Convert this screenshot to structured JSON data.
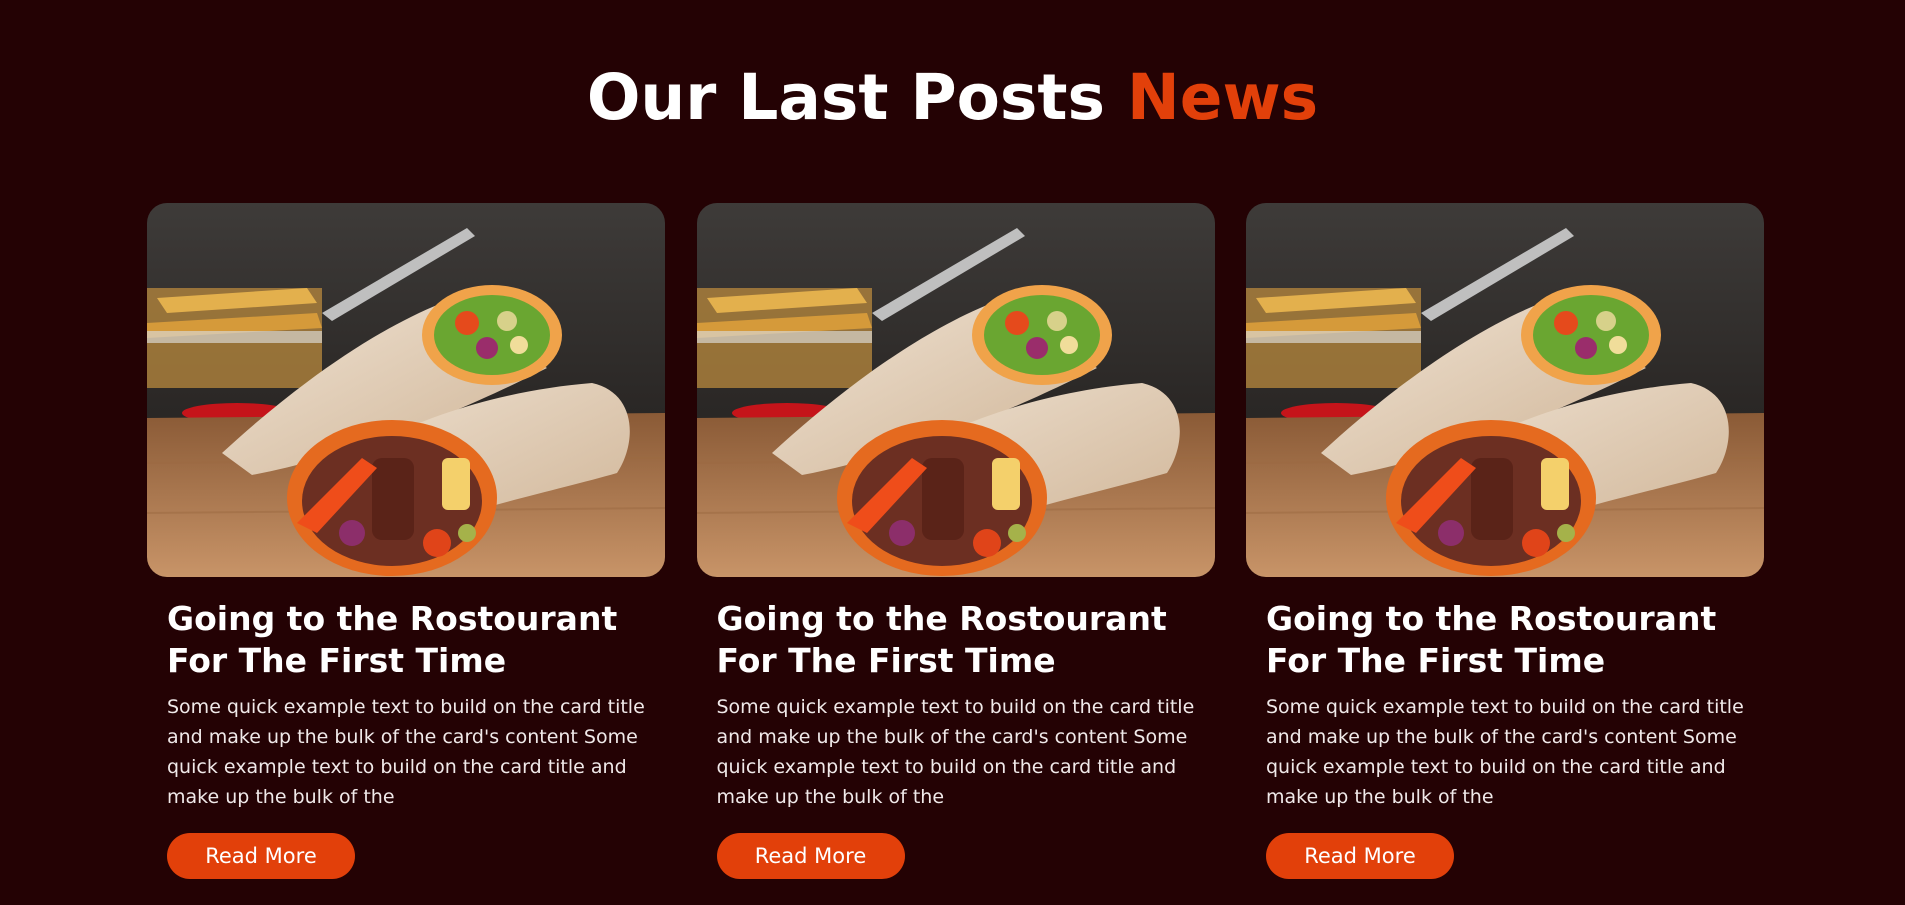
{
  "section": {
    "heading_main": "Our Last Posts",
    "heading_accent": "News"
  },
  "theme": {
    "background": "#240204",
    "accent": "#e2400a",
    "text": "#ffffff"
  },
  "cards": [
    {
      "image_alt": "wrap-sandwich-photo",
      "title": "Going to the Rostourant For The First Time",
      "text": "Some quick example text to build on the card title and make up the bulk of the card's content Some quick example text to build on the card title and make up the bulk of the",
      "button_label": "Read More"
    },
    {
      "image_alt": "wrap-sandwich-photo",
      "title": "Going to the Rostourant For The First Time",
      "text": "Some quick example text to build on the card title and make up the bulk of the card's content Some quick example text to build on the card title and make up the bulk of the",
      "button_label": "Read More"
    },
    {
      "image_alt": "wrap-sandwich-photo",
      "title": "Going to the Rostourant For The First Time",
      "text": "Some quick example text to build on the card title and make up the bulk of the card's content Some quick example text to build on the card title and make up the bulk of the",
      "button_label": "Read More"
    }
  ]
}
